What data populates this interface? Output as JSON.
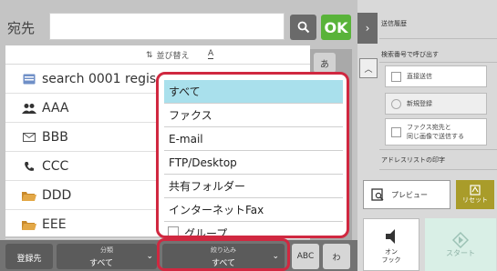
{
  "header": {
    "destination_label": "宛先",
    "ok_label": "OK"
  },
  "sort": {
    "label": "並び替え",
    "toggle_label": "A"
  },
  "kana_tab": {
    "label": "あ"
  },
  "address_list": [
    {
      "icon": "search-result-icon",
      "text": "search 0001 regis"
    },
    {
      "icon": "group-icon",
      "text": "AAA"
    },
    {
      "icon": "mail-icon",
      "text": "BBB"
    },
    {
      "icon": "phone-icon",
      "text": "CCC"
    },
    {
      "icon": "folder-icon",
      "text": "DDD"
    },
    {
      "icon": "folder-icon",
      "text": "EEE"
    }
  ],
  "dropdown": {
    "items": [
      "すべて",
      "ファクス",
      "E-mail",
      "FTP/Desktop",
      "共有フォルダー",
      "インターネットFax",
      "グループ"
    ],
    "selected_index": 0
  },
  "bottom_bar": {
    "sender_label": "登録先",
    "category_caption": "分類",
    "category_value": "すべて",
    "filter_caption": "絞り込み",
    "filter_value": "すべて",
    "abc_label": "ABC",
    "kana_label": "わ"
  },
  "right_panel": {
    "send_history": "送信履歴",
    "recall_by_number": "検索番号で呼び出す",
    "direct_send": "直接送信",
    "new_register": "新規登録",
    "fax_dest_line1": "ファクス宛先と",
    "fax_dest_line2": "同じ画像で送信する",
    "print_address_list": "アドレスリストの印字",
    "preview": "プレビュー",
    "reset": "リセット",
    "on_hook_line1": "オン",
    "on_hook_line2": "フック",
    "start": "スタート"
  },
  "colors": {
    "ok_green": "#59b33a",
    "highlight_red": "#d02840",
    "selected_blue": "#a9e0ec",
    "reset_olive": "#a99c2a"
  }
}
